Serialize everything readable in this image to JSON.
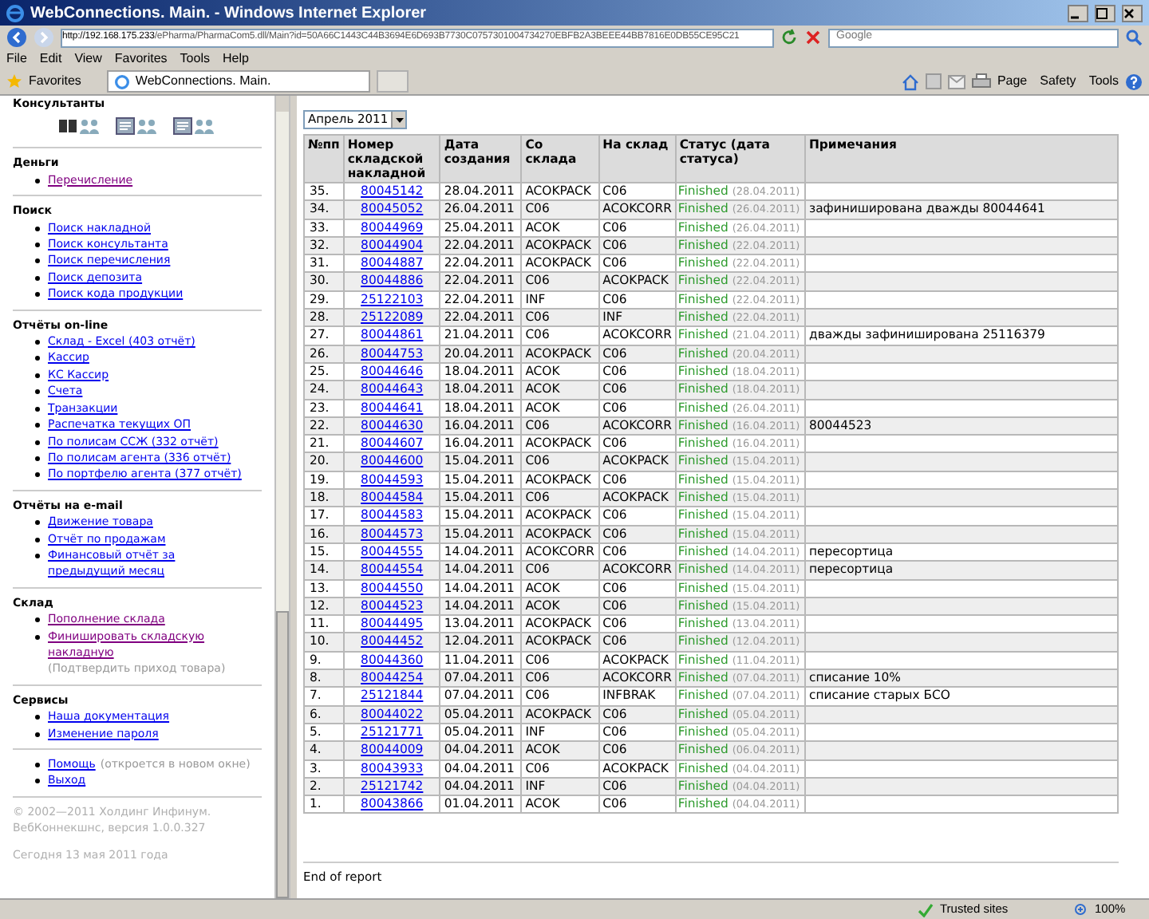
{
  "window": {
    "title": "WebConnections. Main. - Windows Internet Explorer"
  },
  "address": {
    "host": "http://192.168.175.233",
    "path": "/ePharma/PharmaCom5.dll/Main?id=50A66C1443C44B3694E6D693B7730C0757301004734270EBFB2A3BEEE44BB7816E0DB55CE95C21"
  },
  "search": {
    "placeholder": "Google"
  },
  "menu": [
    "File",
    "Edit",
    "View",
    "Favorites",
    "Tools",
    "Help"
  ],
  "favorites": {
    "label": "Favorites",
    "tab": "WebConnections. Main."
  },
  "command_bar": [
    "Page",
    "Safety",
    "Tools"
  ],
  "sidebar": [
    {
      "kind": "icons",
      "title": "Консультанты"
    },
    {
      "kind": "links",
      "title": "Деньги",
      "items": [
        {
          "label": "Перечисление",
          "visited": true
        }
      ]
    },
    {
      "kind": "links",
      "title": "Поиск",
      "items": [
        {
          "label": "Поиск накладной",
          "visited": false
        },
        {
          "label": "Поиск консультанта",
          "visited": false
        },
        {
          "label": "Поиск перечисления",
          "visited": false
        },
        {
          "label": "Поиск депозита",
          "visited": false
        },
        {
          "label": "Поиск кода продукции",
          "visited": false
        }
      ]
    },
    {
      "kind": "links",
      "title": "Отчёты on-line",
      "items": [
        {
          "label": "Склад - Excel (403 отчёт)",
          "visited": false
        },
        {
          "label": "Кассир",
          "visited": false
        },
        {
          "label": "КС Кассир",
          "visited": false
        },
        {
          "label": "Счета",
          "visited": false
        },
        {
          "label": "Транзакции",
          "visited": false
        },
        {
          "label": "Распечатка текущих ОП",
          "visited": false
        },
        {
          "label": "По полисам ССЖ (332 отчёт)",
          "visited": false
        },
        {
          "label": "По полисам агента (336 отчёт)",
          "visited": false
        },
        {
          "label": "По портфелю агента (377 отчёт)",
          "visited": false
        }
      ]
    },
    {
      "kind": "links",
      "title": "Отчёты на e-mail",
      "items": [
        {
          "label": "Движение товара",
          "visited": false
        },
        {
          "label": "Отчёт по продажам",
          "visited": false
        },
        {
          "label": "Финансовый отчёт за предыдущий месяц",
          "visited": false
        }
      ]
    },
    {
      "kind": "links",
      "title": "Склад",
      "items": [
        {
          "label": "Пополнение склада",
          "visited": true
        },
        {
          "label": "Финишировать складскую накладную",
          "visited": true,
          "note": "(Подтвердить приход товара)"
        }
      ]
    },
    {
      "kind": "links",
      "title": "Сервисы",
      "items": [
        {
          "label": "Наша документация",
          "visited": false
        },
        {
          "label": "Изменение пароля",
          "visited": false
        }
      ]
    },
    {
      "kind": "links",
      "items": [
        {
          "label": "Помощь",
          "visited": false,
          "note": "(откроется в новом окне)"
        },
        {
          "label": "Выход",
          "visited": false
        }
      ]
    }
  ],
  "footer": {
    "copyright": "© 2002—2011 Холдинг Инфинум. ВебКоннекшнс, версия 1.0.0.327",
    "today": "Сегодня 13 мая 2011 года"
  },
  "report": {
    "month": "Апрель 2011",
    "columns": [
      "№пп",
      "Номер складской накладной",
      "Дата создания",
      "Со склада",
      "На склад",
      "Статус (дата статуса)",
      "Примечания"
    ],
    "rows": [
      {
        "n": "35.",
        "number": "80045142",
        "created": "28.04.2011",
        "from": "ACOKPACK",
        "to": "C06",
        "status": "Finished",
        "status_date": "(28.04.2011)"
      },
      {
        "n": "34.",
        "number": "80045052",
        "created": "26.04.2011",
        "from": "C06",
        "to": "ACOKCORR",
        "status": "Finished",
        "status_date": "(26.04.2011)",
        "note": "зафиниширована дважды 80044641"
      },
      {
        "n": "33.",
        "number": "80044969",
        "created": "25.04.2011",
        "from": "ACOK",
        "to": "C06",
        "status": "Finished",
        "status_date": "(26.04.2011)"
      },
      {
        "n": "32.",
        "number": "80044904",
        "created": "22.04.2011",
        "from": "ACOKPACK",
        "to": "C06",
        "status": "Finished",
        "status_date": "(22.04.2011)"
      },
      {
        "n": "31.",
        "number": "80044887",
        "created": "22.04.2011",
        "from": "ACOKPACK",
        "to": "C06",
        "status": "Finished",
        "status_date": "(22.04.2011)"
      },
      {
        "n": "30.",
        "number": "80044886",
        "created": "22.04.2011",
        "from": "C06",
        "to": "ACOKPACK",
        "status": "Finished",
        "status_date": "(22.04.2011)"
      },
      {
        "n": "29.",
        "number": "25122103",
        "created": "22.04.2011",
        "from": "INF",
        "to": "C06",
        "status": "Finished",
        "status_date": "(22.04.2011)"
      },
      {
        "n": "28.",
        "number": "25122089",
        "created": "22.04.2011",
        "from": "C06",
        "to": "INF",
        "status": "Finished",
        "status_date": "(22.04.2011)"
      },
      {
        "n": "27.",
        "number": "80044861",
        "created": "21.04.2011",
        "from": "C06",
        "to": "ACOKCORR",
        "status": "Finished",
        "status_date": "(21.04.2011)",
        "note": "дважды зафиниширована 25116379"
      },
      {
        "n": "26.",
        "number": "80044753",
        "created": "20.04.2011",
        "from": "ACOKPACK",
        "to": "C06",
        "status": "Finished",
        "status_date": "(20.04.2011)"
      },
      {
        "n": "25.",
        "number": "80044646",
        "created": "18.04.2011",
        "from": "ACOK",
        "to": "C06",
        "status": "Finished",
        "status_date": "(18.04.2011)"
      },
      {
        "n": "24.",
        "number": "80044643",
        "created": "18.04.2011",
        "from": "ACOK",
        "to": "C06",
        "status": "Finished",
        "status_date": "(18.04.2011)"
      },
      {
        "n": "23.",
        "number": "80044641",
        "created": "18.04.2011",
        "from": "ACOK",
        "to": "C06",
        "status": "Finished",
        "status_date": "(26.04.2011)"
      },
      {
        "n": "22.",
        "number": "80044630",
        "created": "16.04.2011",
        "from": "C06",
        "to": "ACOKCORR",
        "status": "Finished",
        "status_date": "(16.04.2011)",
        "note": "80044523"
      },
      {
        "n": "21.",
        "number": "80044607",
        "created": "16.04.2011",
        "from": "ACOKPACK",
        "to": "C06",
        "status": "Finished",
        "status_date": "(16.04.2011)"
      },
      {
        "n": "20.",
        "number": "80044600",
        "created": "15.04.2011",
        "from": "C06",
        "to": "ACOKPACK",
        "status": "Finished",
        "status_date": "(15.04.2011)"
      },
      {
        "n": "19.",
        "number": "80044593",
        "created": "15.04.2011",
        "from": "ACOKPACK",
        "to": "C06",
        "status": "Finished",
        "status_date": "(15.04.2011)"
      },
      {
        "n": "18.",
        "number": "80044584",
        "created": "15.04.2011",
        "from": "C06",
        "to": "ACOKPACK",
        "status": "Finished",
        "status_date": "(15.04.2011)"
      },
      {
        "n": "17.",
        "number": "80044583",
        "created": "15.04.2011",
        "from": "ACOKPACK",
        "to": "C06",
        "status": "Finished",
        "status_date": "(15.04.2011)"
      },
      {
        "n": "16.",
        "number": "80044573",
        "created": "15.04.2011",
        "from": "ACOKPACK",
        "to": "C06",
        "status": "Finished",
        "status_date": "(15.04.2011)"
      },
      {
        "n": "15.",
        "number": "80044555",
        "created": "14.04.2011",
        "from": "ACOKCORR",
        "to": "C06",
        "status": "Finished",
        "status_date": "(14.04.2011)",
        "note": "пересортица"
      },
      {
        "n": "14.",
        "number": "80044554",
        "created": "14.04.2011",
        "from": "C06",
        "to": "ACOKCORR",
        "status": "Finished",
        "status_date": "(14.04.2011)",
        "note": "пересортица"
      },
      {
        "n": "13.",
        "number": "80044550",
        "created": "14.04.2011",
        "from": "ACOK",
        "to": "C06",
        "status": "Finished",
        "status_date": "(15.04.2011)"
      },
      {
        "n": "12.",
        "number": "80044523",
        "created": "14.04.2011",
        "from": "ACOK",
        "to": "C06",
        "status": "Finished",
        "status_date": "(15.04.2011)"
      },
      {
        "n": "11.",
        "number": "80044495",
        "created": "13.04.2011",
        "from": "ACOKPACK",
        "to": "C06",
        "status": "Finished",
        "status_date": "(13.04.2011)"
      },
      {
        "n": "10.",
        "number": "80044452",
        "created": "12.04.2011",
        "from": "ACOKPACK",
        "to": "C06",
        "status": "Finished",
        "status_date": "(12.04.2011)"
      },
      {
        "n": "9.",
        "number": "80044360",
        "created": "11.04.2011",
        "from": "C06",
        "to": "ACOKPACK",
        "status": "Finished",
        "status_date": "(11.04.2011)"
      },
      {
        "n": "8.",
        "number": "80044254",
        "created": "07.04.2011",
        "from": "C06",
        "to": "ACOKCORR",
        "status": "Finished",
        "status_date": "(07.04.2011)",
        "note": "списание 10%"
      },
      {
        "n": "7.",
        "number": "25121844",
        "created": "07.04.2011",
        "from": "C06",
        "to": "INFBRAK",
        "status": "Finished",
        "status_date": "(07.04.2011)",
        "note": "списание старых БСО"
      },
      {
        "n": "6.",
        "number": "80044022",
        "created": "05.04.2011",
        "from": "ACOKPACK",
        "to": "C06",
        "status": "Finished",
        "status_date": "(05.04.2011)"
      },
      {
        "n": "5.",
        "number": "25121771",
        "created": "05.04.2011",
        "from": "INF",
        "to": "C06",
        "status": "Finished",
        "status_date": "(05.04.2011)"
      },
      {
        "n": "4.",
        "number": "80044009",
        "created": "04.04.2011",
        "from": "ACOK",
        "to": "C06",
        "status": "Finished",
        "status_date": "(06.04.2011)"
      },
      {
        "n": "3.",
        "number": "80043933",
        "created": "04.04.2011",
        "from": "C06",
        "to": "ACOKPACK",
        "status": "Finished",
        "status_date": "(04.04.2011)"
      },
      {
        "n": "2.",
        "number": "25121742",
        "created": "04.04.2011",
        "from": "INF",
        "to": "C06",
        "status": "Finished",
        "status_date": "(04.04.2011)"
      },
      {
        "n": "1.",
        "number": "80043866",
        "created": "01.04.2011",
        "from": "ACOK",
        "to": "C06",
        "status": "Finished",
        "status_date": "(04.04.2011)"
      }
    ],
    "end_text": "End of report"
  },
  "status_bar": {
    "zone": "Trusted sites",
    "zoom": "100%"
  }
}
